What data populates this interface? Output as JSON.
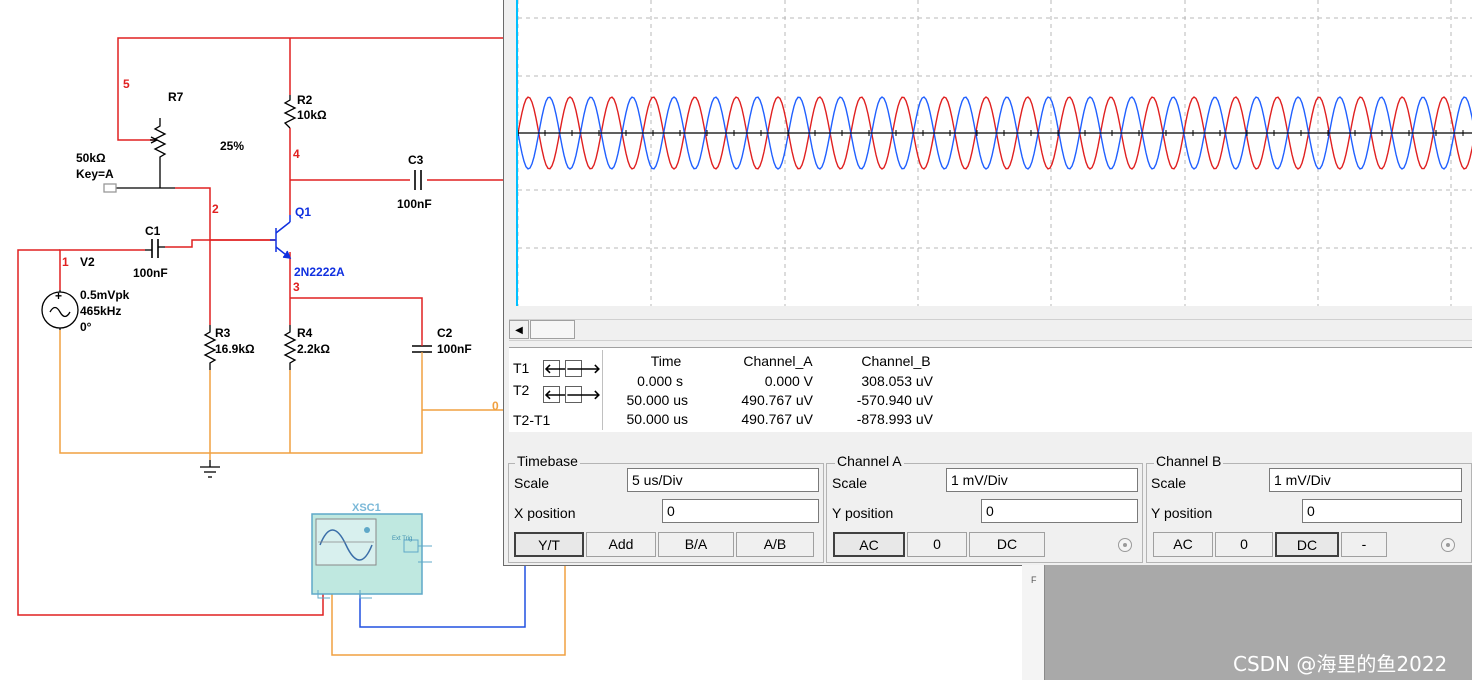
{
  "schematic": {
    "nodes": {
      "n5": "5",
      "n2": "2",
      "n4": "4",
      "n1": "1",
      "n3": "3",
      "n0": "0"
    },
    "r7": {
      "name": "R7",
      "value": "50kΩ",
      "key": "Key=A",
      "percent": "25%"
    },
    "r2": {
      "name": "R2",
      "value": "10kΩ"
    },
    "r3": {
      "name": "R3",
      "value": "16.9kΩ"
    },
    "r4": {
      "name": "R4",
      "value": "2.2kΩ"
    },
    "c1": {
      "name": "C1",
      "value": "100nF"
    },
    "c2": {
      "name": "C2",
      "value": "100nF"
    },
    "c3": {
      "name": "C3",
      "value": "100nF"
    },
    "q1": {
      "name": "Q1",
      "model": "2N2222A"
    },
    "v2": {
      "name": "V2",
      "amplitude": "0.5mVpk",
      "freq": "465kHz",
      "phase": "0°"
    },
    "xsc1": {
      "name": "XSC1",
      "ext_trig": "Ext Trig"
    },
    "colors": {
      "wire_red": "#e02020",
      "wire_orange": "#f0a040",
      "wire_blue": "#2050e0",
      "label_red": "#e02020",
      "label_blue": "#1030e0"
    }
  },
  "scope": {
    "cursor": {
      "t1": "T1",
      "t2": "T2",
      "t2t1": "T2-T1"
    },
    "measurements": {
      "headers": [
        "Time",
        "Channel_A",
        "Channel_B"
      ],
      "rows": [
        [
          "0.000 s",
          "0.000 V",
          "308.053 uV"
        ],
        [
          "50.000 us",
          "490.767 uV",
          "-570.940 uV"
        ],
        [
          "50.000 us",
          "490.767 uV",
          "-878.993 uV"
        ]
      ]
    },
    "timebase": {
      "title": "Timebase",
      "scale_label": "Scale",
      "scale": "5 us/Div",
      "xpos_label": "X position",
      "xpos": "0",
      "buttons": [
        "Y/T",
        "Add",
        "B/A",
        "A/B"
      ],
      "active": "Y/T"
    },
    "channel_a": {
      "title": "Channel A",
      "scale_label": "Scale",
      "scale": "1 mV/Div",
      "ypos_label": "Y position",
      "ypos": "0",
      "buttons": [
        "AC",
        "0",
        "DC"
      ],
      "active": "AC"
    },
    "channel_b": {
      "title": "Channel B",
      "scale_label": "Scale",
      "scale": "1 mV/Div",
      "ypos_label": "Y position",
      "ypos": "0",
      "buttons": [
        "AC",
        "0",
        "DC",
        "-"
      ],
      "active": "DC"
    },
    "traces": {
      "channel_a_color": "#e02020",
      "channel_b_color": "#2060ff",
      "cycles_visible": 23,
      "amplitude_uV": 500
    }
  },
  "lower_panel_letter": "F",
  "watermark": "CSDN @海里的鱼2022"
}
